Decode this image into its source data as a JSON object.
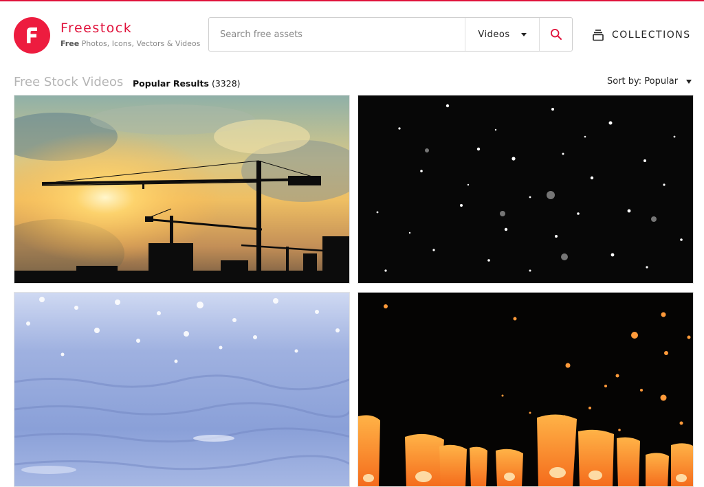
{
  "brand": {
    "name": "Freestock",
    "tagline_bold": "Free",
    "tagline_rest": " Photos, Icons, Vectors & Videos",
    "accent": "#e0123b"
  },
  "search": {
    "placeholder": "Search free assets",
    "value": "",
    "type_selected": "Videos",
    "search_icon": "magnifier-icon"
  },
  "nav": {
    "collections_label": "COLLECTIONS",
    "collections_icon": "stack-icon"
  },
  "results": {
    "page_title": "Free Stock Videos",
    "label": "Popular Results",
    "count": "(3328)",
    "sort_label": "Sort by: Popular"
  },
  "videos": [
    {
      "subject": "construction cranes silhouette at sunset"
    },
    {
      "subject": "snowflakes falling on black background"
    },
    {
      "subject": "sparkling blue water surface"
    },
    {
      "subject": "floating sky lanterns at night"
    }
  ]
}
